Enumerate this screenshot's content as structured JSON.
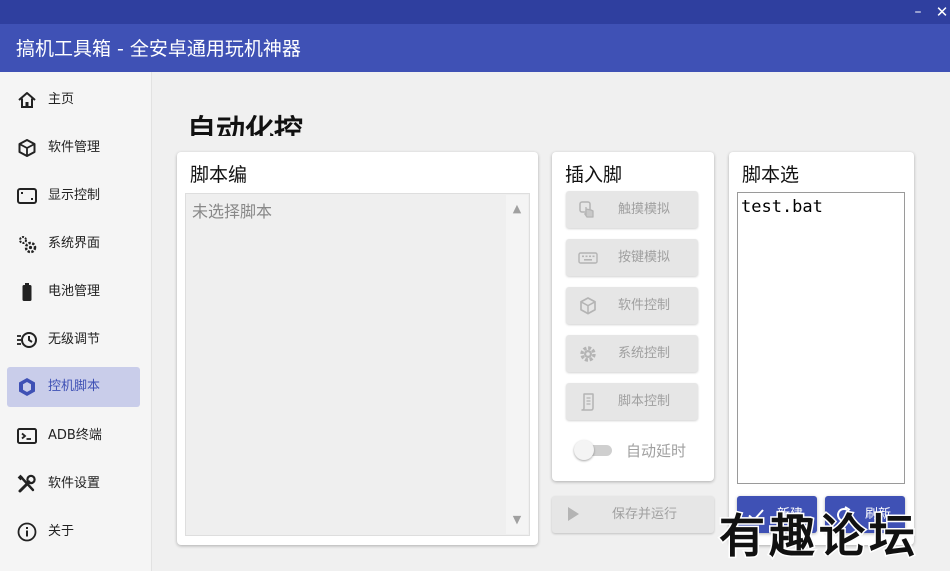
{
  "window": {
    "title": "搞机工具箱 - 全安卓通用玩机神器",
    "minimize_glyph": "–",
    "close_glyph": "✕"
  },
  "sidebar": {
    "items": [
      {
        "label": "主页",
        "icon": "home-icon",
        "active": false
      },
      {
        "label": "软件管理",
        "icon": "package-icon",
        "active": false
      },
      {
        "label": "显示控制",
        "icon": "display-frame-icon",
        "active": false
      },
      {
        "label": "系统界面",
        "icon": "gears-icon",
        "active": false
      },
      {
        "label": "电池管理",
        "icon": "battery-icon",
        "active": false
      },
      {
        "label": "无级调节",
        "icon": "speed-clock-icon",
        "active": false
      },
      {
        "label": "控机脚本",
        "icon": "hexagon-icon",
        "active": true
      },
      {
        "label": "ADB终端",
        "icon": "terminal-icon",
        "active": false
      },
      {
        "label": "软件设置",
        "icon": "tools-icon",
        "active": false
      },
      {
        "label": "关于",
        "icon": "info-icon",
        "active": false
      }
    ]
  },
  "page": {
    "title": "自动化控"
  },
  "editor": {
    "title": "脚本编",
    "placeholder": "未选择脚本"
  },
  "insert": {
    "title": "插入脚",
    "buttons": [
      {
        "label": "触摸模拟",
        "icon": "touch-icon"
      },
      {
        "label": "按键模拟",
        "icon": "keyboard-icon"
      },
      {
        "label": "软件控制",
        "icon": "package-icon"
      },
      {
        "label": "系统控制",
        "icon": "gear-icon"
      },
      {
        "label": "脚本控制",
        "icon": "script-icon"
      }
    ],
    "toggle_label": "自动延时",
    "toggle_on": false
  },
  "run_button": {
    "label": "保存并运行",
    "icon": "play-icon"
  },
  "selector": {
    "title": "脚本选",
    "items": [
      "test.bat"
    ],
    "new_label": "新建",
    "refresh_label": "刷新"
  },
  "watermark": {
    "text": "有趣论坛"
  },
  "colors": {
    "accent": "#3f51b5",
    "titlebar_top": "#2f3f9f",
    "active_nav_bg": "#c9cdea",
    "disabled_text": "#a0a0a0"
  }
}
